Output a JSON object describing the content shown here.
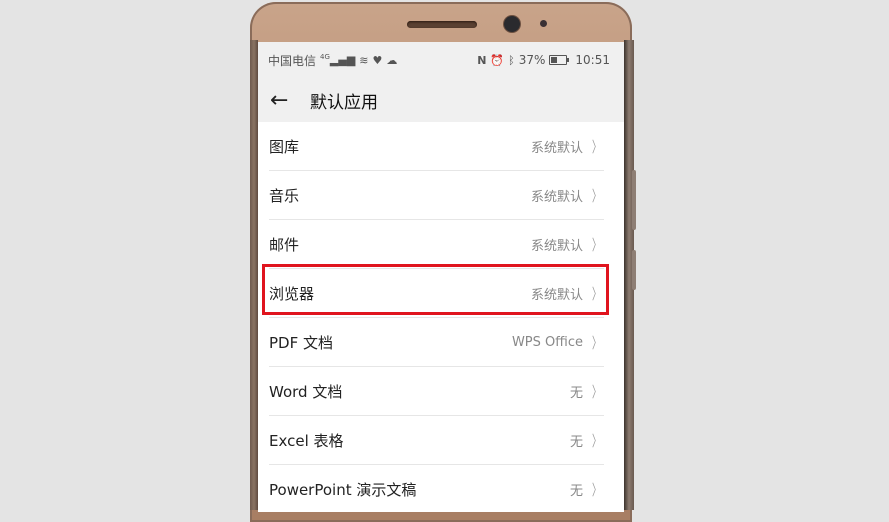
{
  "status_bar": {
    "carrier": "中国电信",
    "network": "4G",
    "battery_percent": "37%",
    "battery_level": 0.37,
    "time": "10:51",
    "left_icons": [
      "signal-icon",
      "wifi-icon",
      "heart-icon",
      "cloud-icon"
    ],
    "right_icons": [
      "nfc-icon",
      "alarm-icon",
      "bluetooth-icon",
      "battery-icon"
    ]
  },
  "app_bar": {
    "title": "默认应用",
    "back_icon": "arrow-left-icon"
  },
  "settings": [
    {
      "label": "图库",
      "value": "系统默认"
    },
    {
      "label": "音乐",
      "value": "系统默认"
    },
    {
      "label": "邮件",
      "value": "系统默认"
    },
    {
      "label": "浏览器",
      "value": "系统默认",
      "highlighted": true
    },
    {
      "label": "PDF 文档",
      "value": "WPS Office"
    },
    {
      "label": "Word 文档",
      "value": "无"
    },
    {
      "label": "Excel 表格",
      "value": "无"
    },
    {
      "label": "PowerPoint 演示文稿",
      "value": "无"
    }
  ],
  "highlight_color": "#e0141e"
}
